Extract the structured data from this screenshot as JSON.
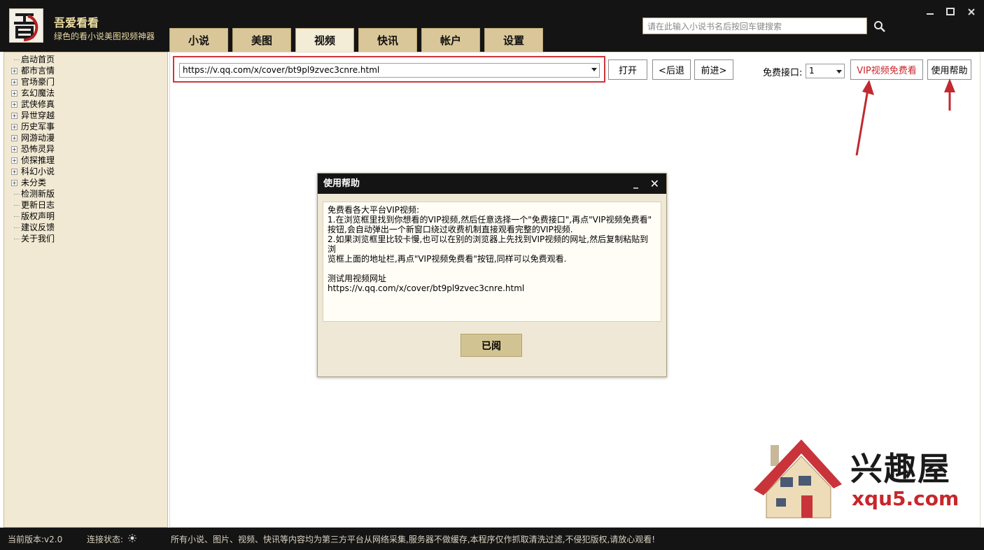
{
  "app": {
    "title": "吾爱看看",
    "subtitle": "绿色的看小说美图视频神器"
  },
  "tabs": [
    {
      "label": "小说"
    },
    {
      "label": "美图"
    },
    {
      "label": "视频"
    },
    {
      "label": "快讯"
    },
    {
      "label": "帐户"
    },
    {
      "label": "设置"
    }
  ],
  "active_tab": "视频",
  "search": {
    "placeholder": "请在此输入小说书名后按回车键搜索"
  },
  "sidebar": {
    "items": [
      {
        "label": "启动首页",
        "expandable": false
      },
      {
        "label": "都市言情",
        "expandable": true
      },
      {
        "label": "官场豪门",
        "expandable": true
      },
      {
        "label": "玄幻魔法",
        "expandable": true
      },
      {
        "label": "武侠修真",
        "expandable": true
      },
      {
        "label": "异世穿越",
        "expandable": true
      },
      {
        "label": "历史军事",
        "expandable": true
      },
      {
        "label": "网游动漫",
        "expandable": true
      },
      {
        "label": "恐怖灵异",
        "expandable": true
      },
      {
        "label": "侦探推理",
        "expandable": true
      },
      {
        "label": "科幻小说",
        "expandable": true
      },
      {
        "label": "未分类",
        "expandable": true
      },
      {
        "label": "检测新版",
        "expandable": false
      },
      {
        "label": "更新日志",
        "expandable": false
      },
      {
        "label": "版权声明",
        "expandable": false
      },
      {
        "label": "建议反馈",
        "expandable": false
      },
      {
        "label": "关于我们",
        "expandable": false
      }
    ]
  },
  "toolbar": {
    "url": "https://v.qq.com/x/cover/bt9pl9zvec3cnre.html",
    "open_label": "打开",
    "back_label": "<后退",
    "forward_label": "前进>",
    "interface_label": "免费接口:",
    "interface_value": "1",
    "vip_label": "VIP视频免费看",
    "help_label": "使用帮助"
  },
  "dialog": {
    "title": "使用帮助",
    "lines": [
      "免费看各大平台VIP视频:",
      "1.在浏览框里找到你想看的VIP视频,然后任意选择一个\"免费接口\",再点\"VIP视频免费看\"",
      "按钮,会自动弹出一个新窗口绕过收费机制直接观看完整的VIP视频.",
      "2.如果浏览框里比较卡慢,也可以在别的浏览器上先找到VIP视频的网址,然后复制粘贴到浏",
      "览框上面的地址栏,再点\"VIP视频免费看\"按钮,同样可以免费观看.",
      "",
      "测试用视频网址",
      "https://v.qq.com/x/cover/bt9pl9zvec3cnre.html"
    ],
    "ok_label": "已阅"
  },
  "statusbar": {
    "version": "当前版本:v2.0",
    "connection": "连接状态:",
    "notice": "所有小说、图片、视频、快讯等内容均为第三方平台从网络采集,服务器不做缓存,本程序仅作抓取清洗过滤,不侵犯版权,请放心观看!"
  },
  "watermark": {
    "brand": "兴趣屋",
    "domain": "xqu5.com"
  },
  "colors": {
    "titlebar": "#141414",
    "tab": "#d9c79a",
    "accent_red": "#d2353a",
    "sidebar": "#f1e9d3"
  }
}
